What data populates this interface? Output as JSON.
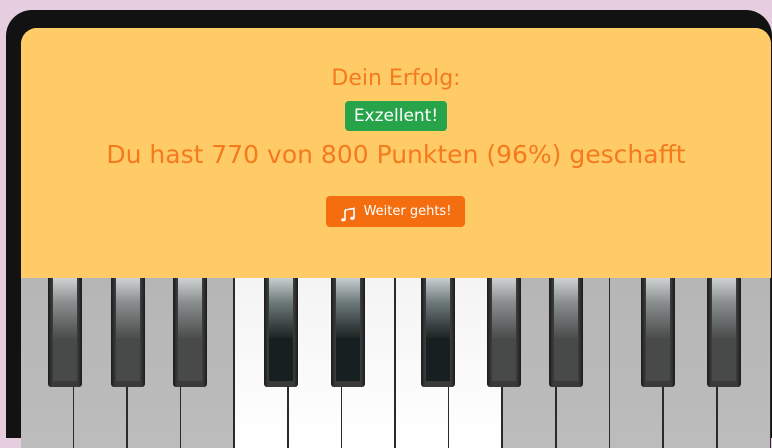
{
  "result": {
    "headline": "Dein Erfolg:",
    "badge": "Exzellent!",
    "score_text": "Du hast 770 von 800 Punkten (96%) geschafft",
    "continue_label": "Weiter gehts!",
    "points_scored": 770,
    "points_total": 800,
    "percent": 96
  },
  "icons": {
    "continue_icon": "music-note-icon"
  },
  "colors": {
    "background": "#e6cde0",
    "panel": "#ffcb66",
    "text_accent": "#f57a1e",
    "badge": "#27a44a",
    "button": "#f46d0f",
    "white_key_inactive": "#b9b9b9",
    "white_key_active": "#ffffff"
  },
  "keyboard": {
    "white_keys": [
      {
        "state": "inactive"
      },
      {
        "state": "inactive"
      },
      {
        "state": "inactive"
      },
      {
        "state": "inactive"
      },
      {
        "state": "active"
      },
      {
        "state": "active"
      },
      {
        "state": "active"
      },
      {
        "state": "active"
      },
      {
        "state": "active"
      },
      {
        "state": "inactive"
      },
      {
        "state": "inactive"
      },
      {
        "state": "inactive"
      },
      {
        "state": "inactive"
      },
      {
        "state": "inactive"
      },
      {
        "state": "inactive"
      }
    ],
    "black_keys": [
      {
        "state": "inactive"
      },
      {
        "state": "inactive"
      },
      {
        "state": "inactive"
      },
      {
        "state": "active"
      },
      {
        "state": "active"
      },
      {
        "state": "active"
      },
      {
        "state": "inactive"
      },
      {
        "state": "inactive"
      },
      {
        "state": "inactive"
      },
      {
        "state": "inactive"
      }
    ]
  }
}
